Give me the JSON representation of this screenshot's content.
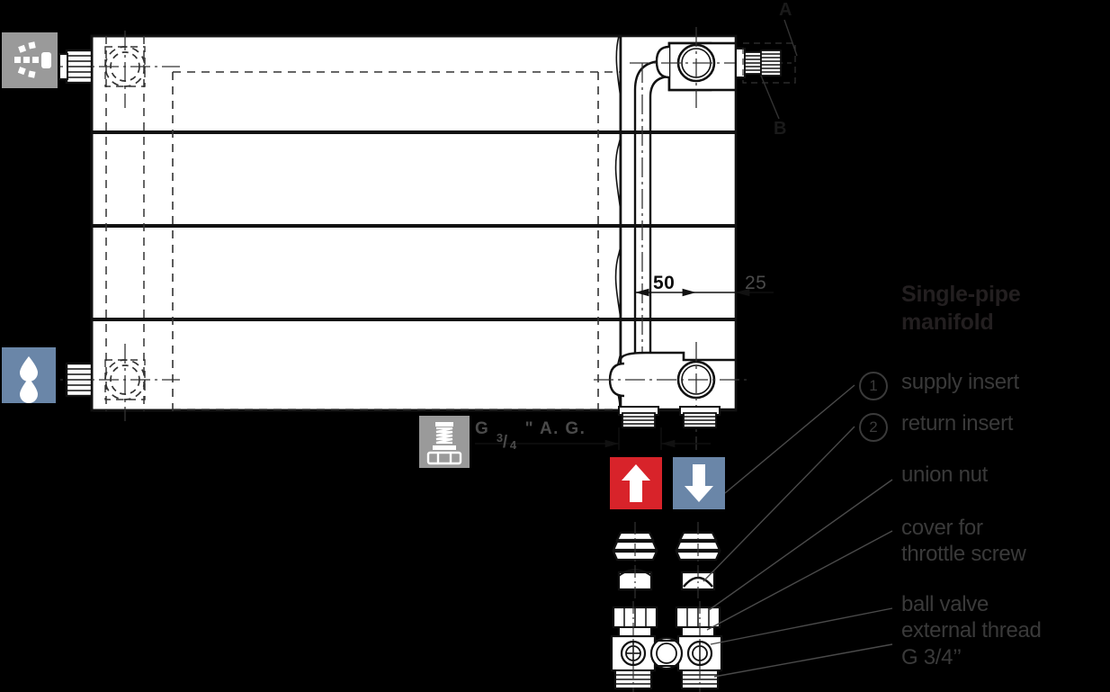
{
  "diagram": {
    "title": "Single-pipe manifold radiator connection drawing",
    "dimensions": {
      "d50": "50",
      "d25": "25",
      "thread_label_prefix": "G",
      "thread_numerator": "3",
      "thread_denominator": "4",
      "thread_suffix": "\" A. G."
    },
    "callouts": {
      "a": "A",
      "b": "B"
    }
  },
  "legend": {
    "title": "Single-pipe\nmanifold",
    "items": [
      {
        "marker": "1",
        "label": "supply insert"
      },
      {
        "marker": "2",
        "label": "return insert"
      },
      {
        "marker": "",
        "label": "union nut"
      },
      {
        "marker": "",
        "label": "cover for\nthrottle screw"
      },
      {
        "marker": "",
        "label": "ball valve\nexternal thread\nG 3/4’’"
      }
    ]
  },
  "icons": {
    "air_vent": "air-vent-icon",
    "water_drops": "water-drops-icon",
    "threaded_bolt": "threaded-bolt-icon",
    "supply_arrow": "arrow-up-icon",
    "return_arrow": "arrow-down-icon"
  },
  "colors": {
    "supply_red": "#d8232a",
    "return_blue": "#6a86a8",
    "icon_gray": "#9a9a9a",
    "text_dark": "#231f20",
    "text_gray": "#3a3a3a",
    "line": "#111111",
    "background": "#000000",
    "body_fill": "#ffffff"
  }
}
